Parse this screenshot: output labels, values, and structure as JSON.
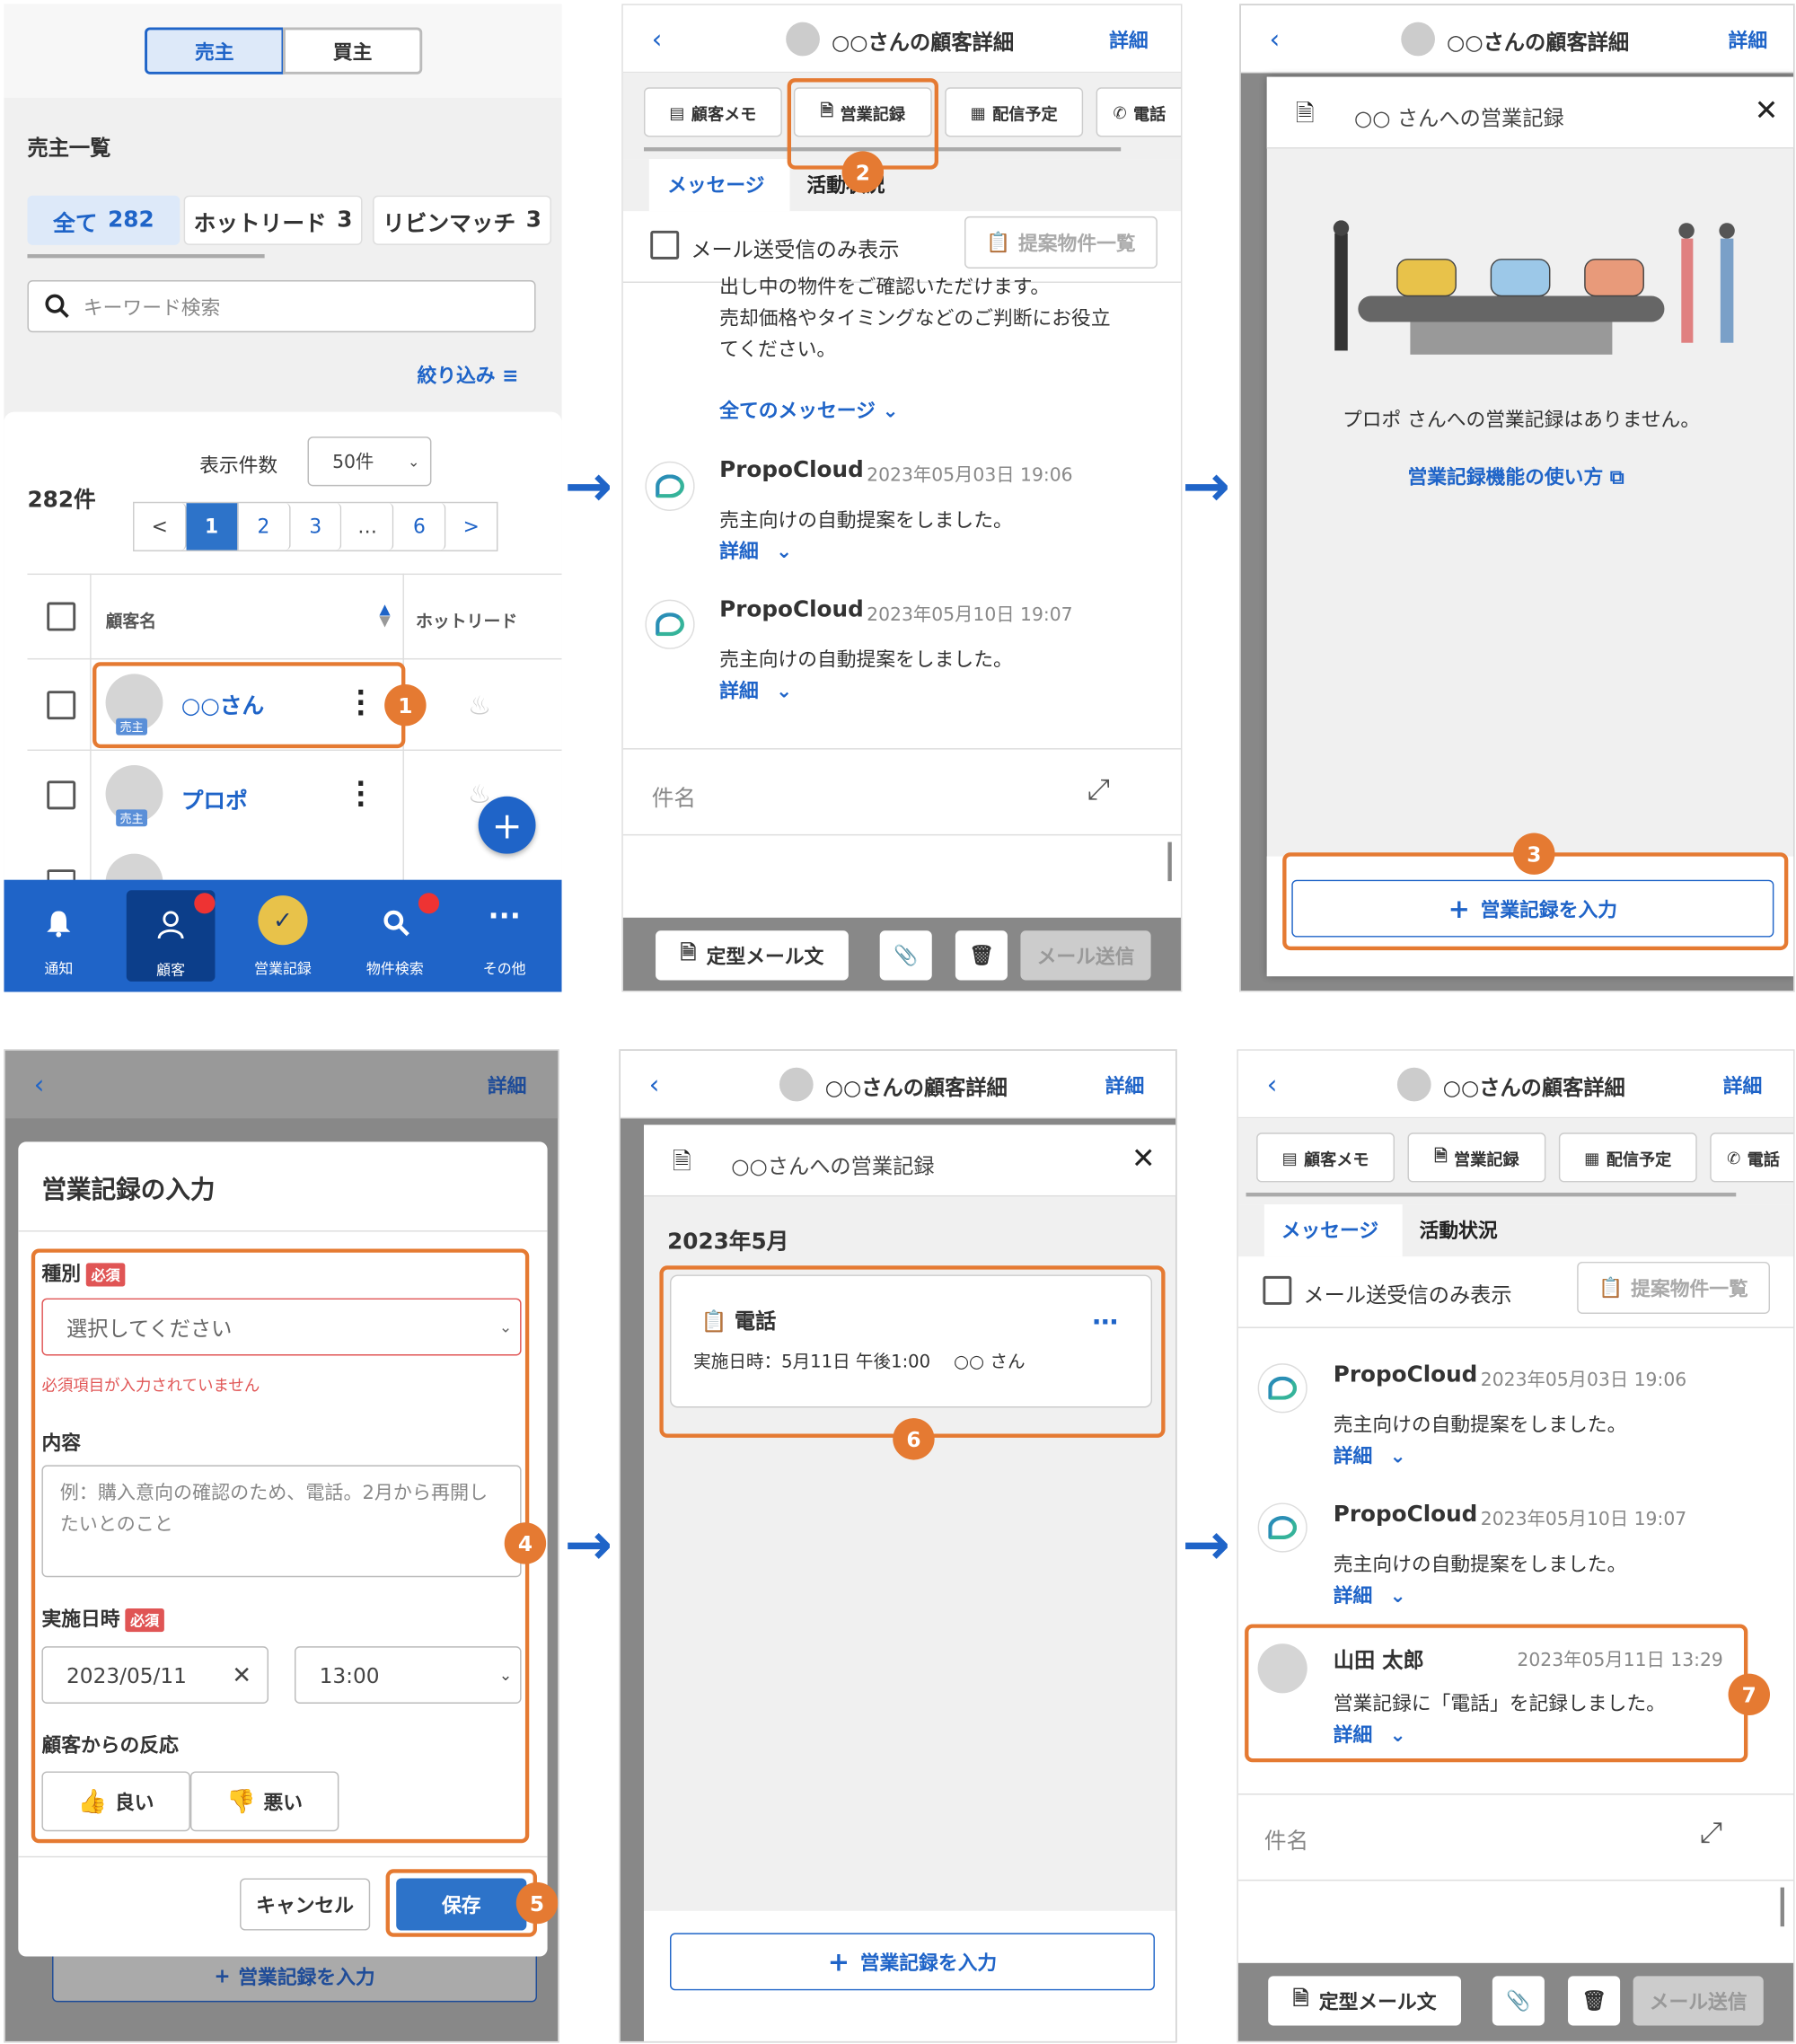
{
  "arrow_glyph": "→",
  "panel1": {
    "toggle": [
      "売主",
      "買主"
    ],
    "list_title": "売主一覧",
    "filters": [
      {
        "label": "全て",
        "count": "282"
      },
      {
        "label": "ホットリード",
        "count": "3"
      },
      {
        "label": "リビンマッチ",
        "count": "3"
      }
    ],
    "search_placeholder": "キーワード検索",
    "narrow": "絞り込み",
    "per_page_label": "表示件数",
    "per_page_value": "50件",
    "total": "282件",
    "pages": [
      "<",
      "1",
      "2",
      "3",
      "…",
      "6",
      ">"
    ],
    "col_name": "顧客名",
    "col_hot": "ホットリード",
    "rows": [
      {
        "name": "○○さん",
        "tag": "売主"
      },
      {
        "name": "プロポ",
        "tag": "売主"
      }
    ],
    "nav": [
      "通知",
      "顧客",
      "営業記録",
      "物件検索",
      "その他"
    ],
    "fab": "+",
    "step": "1"
  },
  "panel2": {
    "header_title": "○○さんの顧客詳細",
    "detail": "詳細",
    "tabs": [
      "顧客メモ",
      "営業記録",
      "配信予定",
      "電話"
    ],
    "subtabs": [
      "メッセージ",
      "活動状況"
    ],
    "only_mail": "メール送受信のみ表示",
    "proposal_list": "提案物件一覧",
    "partial_text": [
      "出し中の物件をご確認いただけます。",
      "売却価格やタイミングなどのご判断にお役立",
      "てください。"
    ],
    "all_messages": "全てのメッセージ",
    "messages": [
      {
        "sender": "PropoCloud",
        "time": "2023年05月03日 19:06",
        "text": "売主向けの自動提案をしました。",
        "detail": "詳細"
      },
      {
        "sender": "PropoCloud",
        "time": "2023年05月10日 19:07",
        "text": "売主向けの自動提案をしました。",
        "detail": "詳細"
      }
    ],
    "subject": "件名",
    "template": "定型メール文",
    "send": "メール送信",
    "step": "2"
  },
  "panel3": {
    "header_title": "○○さんの顧客詳細",
    "detail": "詳細",
    "modal_title": "○○ さんへの営業記録",
    "empty": "プロポ さんへの営業記録はありません。",
    "howto": "営業記録機能の使い方",
    "add_btn": "営業記録を入力",
    "step": "3"
  },
  "panel4": {
    "detail": "詳細",
    "title": "営業記録の入力",
    "type_label": "種別",
    "required": "必須",
    "select_placeholder": "選択してください",
    "error": "必須項目が入力されていません",
    "content_label": "内容",
    "content_placeholder": [
      "例：購入意向の確認のため、電話。2月から再開し",
      "たいとのこと"
    ],
    "date_label": "実施日時",
    "date": "2023/05/11",
    "time": "13:00",
    "reaction_label": "顧客からの反応",
    "good": "良い",
    "bad": "悪い",
    "cancel": "キャンセル",
    "save": "保存",
    "behind_btn": "営業記録を入力",
    "step4": "4",
    "step5": "5"
  },
  "panel5": {
    "header_title": "○○さんの顧客詳細",
    "detail": "詳細",
    "modal_title": "○○さんへの営業記録",
    "month": "2023年5月",
    "card_title": "電話",
    "card_meta": "実施日時：5月11日 午後1:00　 ○○ さん",
    "more": "…",
    "add_btn": "営業記録を入力",
    "step": "6"
  },
  "panel6": {
    "header_title": "○○さんの顧客詳細",
    "detail": "詳細",
    "tabs": [
      "顧客メモ",
      "営業記録",
      "配信予定",
      "電話"
    ],
    "subtabs": [
      "メッセージ",
      "活動状況"
    ],
    "only_mail": "メール送受信のみ表示",
    "proposal_list": "提案物件一覧",
    "messages": [
      {
        "sender": "PropoCloud",
        "time": "2023年05月03日 19:06",
        "text": "売主向けの自動提案をしました。",
        "detail": "詳細"
      },
      {
        "sender": "PropoCloud",
        "time": "2023年05月10日 19:07",
        "text": "売主向けの自動提案をしました。",
        "detail": "詳細"
      },
      {
        "sender": "山田 太郎",
        "time": "2023年05月11日 13:29",
        "text": "営業記録に「電話」を記録しました。",
        "detail": "詳細"
      }
    ],
    "subject": "件名",
    "template": "定型メール文",
    "send": "メール送信",
    "step": "7"
  },
  "colors": {
    "accent": "#1f64c8",
    "highlight": "#e57a32",
    "nav": "#1f64c8",
    "error": "#e05555"
  }
}
